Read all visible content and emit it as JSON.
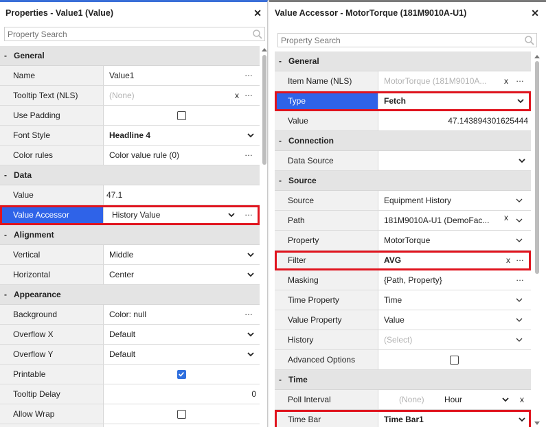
{
  "left": {
    "title": "Properties - Value1 (Value)",
    "search_placeholder": "Property Search",
    "sections": {
      "general": "General",
      "data": "Data",
      "alignment": "Alignment",
      "appearance": "Appearance"
    },
    "toggle": "-",
    "rows": {
      "name": {
        "label": "Name",
        "value": "Value1"
      },
      "tooltip": {
        "label": "Tooltip Text (NLS)",
        "value": "(None)"
      },
      "padding": {
        "label": "Use Padding"
      },
      "font": {
        "label": "Font Style",
        "value": "Headline 4"
      },
      "color": {
        "label": "Color rules",
        "value": "Color value rule (0)"
      },
      "value": {
        "label": "Value",
        "value": "47.1"
      },
      "accessor": {
        "label": "Value Accessor",
        "value": "History Value"
      },
      "vertical": {
        "label": "Vertical",
        "value": "Middle"
      },
      "horizontal": {
        "label": "Horizontal",
        "value": "Center"
      },
      "background": {
        "label": "Background",
        "value": "Color: null"
      },
      "overflowx": {
        "label": "Overflow X",
        "value": "Default"
      },
      "overflowy": {
        "label": "Overflow Y",
        "value": "Default"
      },
      "printable": {
        "label": "Printable",
        "checked": true
      },
      "tooltipdelay": {
        "label": "Tooltip Delay",
        "value": "0"
      },
      "allowwrap": {
        "label": "Allow Wrap",
        "checked": false
      }
    }
  },
  "right": {
    "title": "Value Accessor - MotorTorque (181M9010A-U1)",
    "search_placeholder": "Property Search",
    "sections": {
      "general": "General",
      "connection": "Connection",
      "source": "Source",
      "time": "Time"
    },
    "rows": {
      "itemname": {
        "label": "Item Name (NLS)",
        "value": "MotorTorque (181M9010A..."
      },
      "type": {
        "label": "Type",
        "value": "Fetch"
      },
      "value": {
        "label": "Value",
        "value": "47.143894301625444"
      },
      "datasource": {
        "label": "Data Source",
        "value": ""
      },
      "source": {
        "label": "Source",
        "value": "Equipment History"
      },
      "path": {
        "label": "Path",
        "value": "181M9010A-U1 (DemoFac..."
      },
      "property": {
        "label": "Property",
        "value": "MotorTorque"
      },
      "filter": {
        "label": "Filter",
        "value": "AVG"
      },
      "masking": {
        "label": "Masking",
        "value": "{Path, Property}"
      },
      "timeproperty": {
        "label": "Time Property",
        "value": "Time"
      },
      "valueproperty": {
        "label": "Value Property",
        "value": "Value"
      },
      "history": {
        "label": "History",
        "value": "(Select)"
      },
      "advanced": {
        "label": "Advanced Options"
      },
      "poll": {
        "label": "Poll Interval",
        "value": "(None)",
        "unit": "Hour"
      },
      "timebar": {
        "label": "Time Bar",
        "value": "Time Bar1"
      }
    }
  },
  "glyphs": {
    "close": "✕",
    "clear": "x",
    "more": "..."
  },
  "colors": {
    "highlight_bg": "#2f63e8",
    "highlight_border": "#e0141e",
    "checkbox_on": "#2f6fde"
  }
}
